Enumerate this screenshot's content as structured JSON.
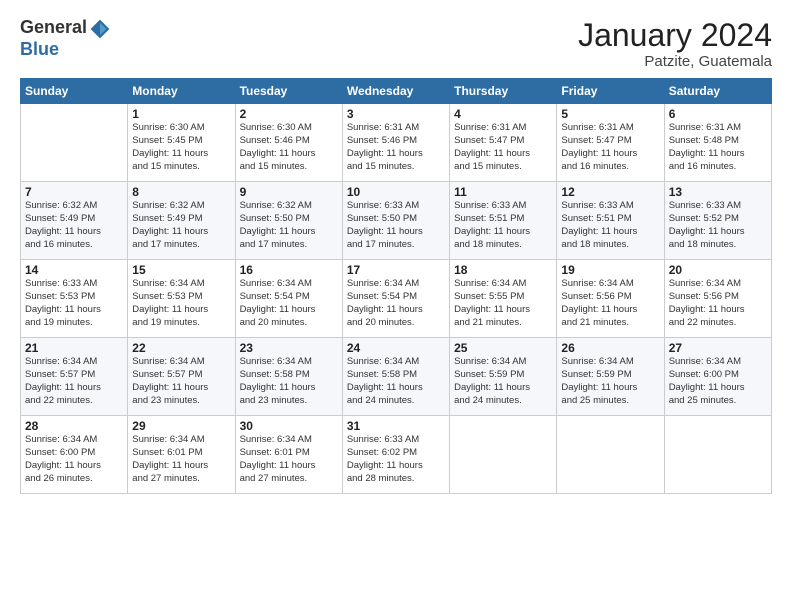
{
  "logo": {
    "general": "General",
    "blue": "Blue"
  },
  "header": {
    "month": "January 2024",
    "location": "Patzite, Guatemala"
  },
  "weekdays": [
    "Sunday",
    "Monday",
    "Tuesday",
    "Wednesday",
    "Thursday",
    "Friday",
    "Saturday"
  ],
  "weeks": [
    [
      {
        "day": "",
        "info": ""
      },
      {
        "day": "1",
        "info": "Sunrise: 6:30 AM\nSunset: 5:45 PM\nDaylight: 11 hours\nand 15 minutes."
      },
      {
        "day": "2",
        "info": "Sunrise: 6:30 AM\nSunset: 5:46 PM\nDaylight: 11 hours\nand 15 minutes."
      },
      {
        "day": "3",
        "info": "Sunrise: 6:31 AM\nSunset: 5:46 PM\nDaylight: 11 hours\nand 15 minutes."
      },
      {
        "day": "4",
        "info": "Sunrise: 6:31 AM\nSunset: 5:47 PM\nDaylight: 11 hours\nand 15 minutes."
      },
      {
        "day": "5",
        "info": "Sunrise: 6:31 AM\nSunset: 5:47 PM\nDaylight: 11 hours\nand 16 minutes."
      },
      {
        "day": "6",
        "info": "Sunrise: 6:31 AM\nSunset: 5:48 PM\nDaylight: 11 hours\nand 16 minutes."
      }
    ],
    [
      {
        "day": "7",
        "info": "Sunrise: 6:32 AM\nSunset: 5:49 PM\nDaylight: 11 hours\nand 16 minutes."
      },
      {
        "day": "8",
        "info": "Sunrise: 6:32 AM\nSunset: 5:49 PM\nDaylight: 11 hours\nand 17 minutes."
      },
      {
        "day": "9",
        "info": "Sunrise: 6:32 AM\nSunset: 5:50 PM\nDaylight: 11 hours\nand 17 minutes."
      },
      {
        "day": "10",
        "info": "Sunrise: 6:33 AM\nSunset: 5:50 PM\nDaylight: 11 hours\nand 17 minutes."
      },
      {
        "day": "11",
        "info": "Sunrise: 6:33 AM\nSunset: 5:51 PM\nDaylight: 11 hours\nand 18 minutes."
      },
      {
        "day": "12",
        "info": "Sunrise: 6:33 AM\nSunset: 5:51 PM\nDaylight: 11 hours\nand 18 minutes."
      },
      {
        "day": "13",
        "info": "Sunrise: 6:33 AM\nSunset: 5:52 PM\nDaylight: 11 hours\nand 18 minutes."
      }
    ],
    [
      {
        "day": "14",
        "info": "Sunrise: 6:33 AM\nSunset: 5:53 PM\nDaylight: 11 hours\nand 19 minutes."
      },
      {
        "day": "15",
        "info": "Sunrise: 6:34 AM\nSunset: 5:53 PM\nDaylight: 11 hours\nand 19 minutes."
      },
      {
        "day": "16",
        "info": "Sunrise: 6:34 AM\nSunset: 5:54 PM\nDaylight: 11 hours\nand 20 minutes."
      },
      {
        "day": "17",
        "info": "Sunrise: 6:34 AM\nSunset: 5:54 PM\nDaylight: 11 hours\nand 20 minutes."
      },
      {
        "day": "18",
        "info": "Sunrise: 6:34 AM\nSunset: 5:55 PM\nDaylight: 11 hours\nand 21 minutes."
      },
      {
        "day": "19",
        "info": "Sunrise: 6:34 AM\nSunset: 5:56 PM\nDaylight: 11 hours\nand 21 minutes."
      },
      {
        "day": "20",
        "info": "Sunrise: 6:34 AM\nSunset: 5:56 PM\nDaylight: 11 hours\nand 22 minutes."
      }
    ],
    [
      {
        "day": "21",
        "info": "Sunrise: 6:34 AM\nSunset: 5:57 PM\nDaylight: 11 hours\nand 22 minutes."
      },
      {
        "day": "22",
        "info": "Sunrise: 6:34 AM\nSunset: 5:57 PM\nDaylight: 11 hours\nand 23 minutes."
      },
      {
        "day": "23",
        "info": "Sunrise: 6:34 AM\nSunset: 5:58 PM\nDaylight: 11 hours\nand 23 minutes."
      },
      {
        "day": "24",
        "info": "Sunrise: 6:34 AM\nSunset: 5:58 PM\nDaylight: 11 hours\nand 24 minutes."
      },
      {
        "day": "25",
        "info": "Sunrise: 6:34 AM\nSunset: 5:59 PM\nDaylight: 11 hours\nand 24 minutes."
      },
      {
        "day": "26",
        "info": "Sunrise: 6:34 AM\nSunset: 5:59 PM\nDaylight: 11 hours\nand 25 minutes."
      },
      {
        "day": "27",
        "info": "Sunrise: 6:34 AM\nSunset: 6:00 PM\nDaylight: 11 hours\nand 25 minutes."
      }
    ],
    [
      {
        "day": "28",
        "info": "Sunrise: 6:34 AM\nSunset: 6:00 PM\nDaylight: 11 hours\nand 26 minutes."
      },
      {
        "day": "29",
        "info": "Sunrise: 6:34 AM\nSunset: 6:01 PM\nDaylight: 11 hours\nand 27 minutes."
      },
      {
        "day": "30",
        "info": "Sunrise: 6:34 AM\nSunset: 6:01 PM\nDaylight: 11 hours\nand 27 minutes."
      },
      {
        "day": "31",
        "info": "Sunrise: 6:33 AM\nSunset: 6:02 PM\nDaylight: 11 hours\nand 28 minutes."
      },
      {
        "day": "",
        "info": ""
      },
      {
        "day": "",
        "info": ""
      },
      {
        "day": "",
        "info": ""
      }
    ]
  ]
}
